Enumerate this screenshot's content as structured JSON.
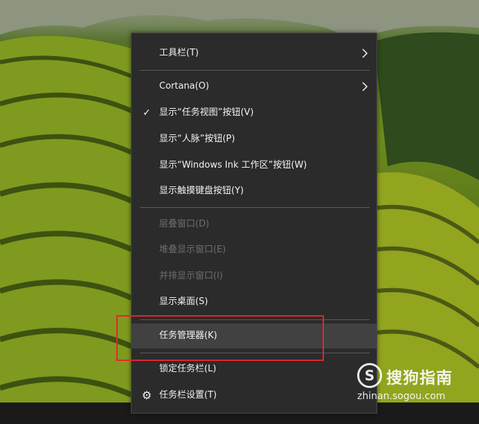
{
  "menu": {
    "items": [
      {
        "label": "工具栏(T)",
        "submenu": true,
        "checked": false,
        "disabled": false
      },
      {
        "label": "Cortana(O)",
        "submenu": true,
        "checked": false,
        "disabled": false
      },
      {
        "label": "显示“任务视图”按钮(V)",
        "submenu": false,
        "checked": true,
        "disabled": false
      },
      {
        "label": "显示“人脉”按钮(P)",
        "submenu": false,
        "checked": false,
        "disabled": false
      },
      {
        "label": "显示“Windows Ink 工作区”按钮(W)",
        "submenu": false,
        "checked": false,
        "disabled": false
      },
      {
        "label": "显示触摸键盘按钮(Y)",
        "submenu": false,
        "checked": false,
        "disabled": false
      },
      {
        "label": "层叠窗口(D)",
        "submenu": false,
        "checked": false,
        "disabled": true
      },
      {
        "label": "堆叠显示窗口(E)",
        "submenu": false,
        "checked": false,
        "disabled": true
      },
      {
        "label": "并排显示窗口(I)",
        "submenu": false,
        "checked": false,
        "disabled": true
      },
      {
        "label": "显示桌面(S)",
        "submenu": false,
        "checked": false,
        "disabled": false
      },
      {
        "label": "任务管理器(K)",
        "submenu": false,
        "checked": false,
        "disabled": false,
        "highlighted": true
      },
      {
        "label": "锁定任务栏(L)",
        "submenu": false,
        "checked": false,
        "disabled": false
      },
      {
        "label": "任务栏设置(T)",
        "submenu": false,
        "checked": false,
        "disabled": false,
        "icon": "gear-icon"
      }
    ],
    "check_glyph": "✓",
    "gear_glyph": "⚙"
  },
  "annotation": {
    "color": "#e3262d"
  },
  "watermark": {
    "logo_letter": "S",
    "brand": "搜狗指南",
    "url": "zhinan.sogou.com"
  },
  "colors": {
    "menu_bg": "#2b2b2b",
    "highlight_bg": "#414141",
    "text": "#f2f2f2",
    "disabled_text": "#6e6e6e"
  }
}
